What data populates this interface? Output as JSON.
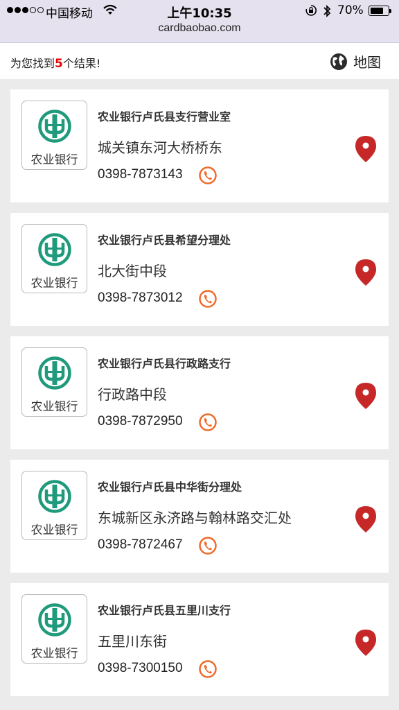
{
  "status_bar": {
    "carrier": "中国移动",
    "time": "上午10:35",
    "battery": "70%",
    "signal_icon": "signal-dots-icon",
    "wifi_icon": "wifi-icon",
    "lock_icon": "rotation-lock-icon",
    "bluetooth_icon": "bluetooth-icon",
    "battery_icon": "battery-icon"
  },
  "url_bar": {
    "url": "cardbaobao.com"
  },
  "header": {
    "count_prefix": "为您找到",
    "count": "5",
    "count_suffix": "个结果!",
    "map_label": "地图",
    "map_icon": "globe-icon",
    "accent": "#e60000"
  },
  "brand": {
    "logo_text": "农业银行",
    "logo_color": "#1f9a7c",
    "pin_color": "#c62828",
    "phone_color": "#f06a2a"
  },
  "results": [
    {
      "name": "农业银行卢氏县支行营业室",
      "address": "城关镇东河大桥桥东",
      "phone": "0398-7873143"
    },
    {
      "name": "农业银行卢氏县希望分理处",
      "address": "北大街中段",
      "phone": "0398-7873012"
    },
    {
      "name": "农业银行卢氏县行政路支行",
      "address": "行政路中段",
      "phone": "0398-7872950"
    },
    {
      "name": "农业银行卢氏县中华街分理处",
      "address": "东城新区永济路与翰林路交汇处",
      "phone": "0398-7872467"
    },
    {
      "name": "农业银行卢氏县五里川支行",
      "address": "五里川东街",
      "phone": "0398-7300150"
    }
  ]
}
